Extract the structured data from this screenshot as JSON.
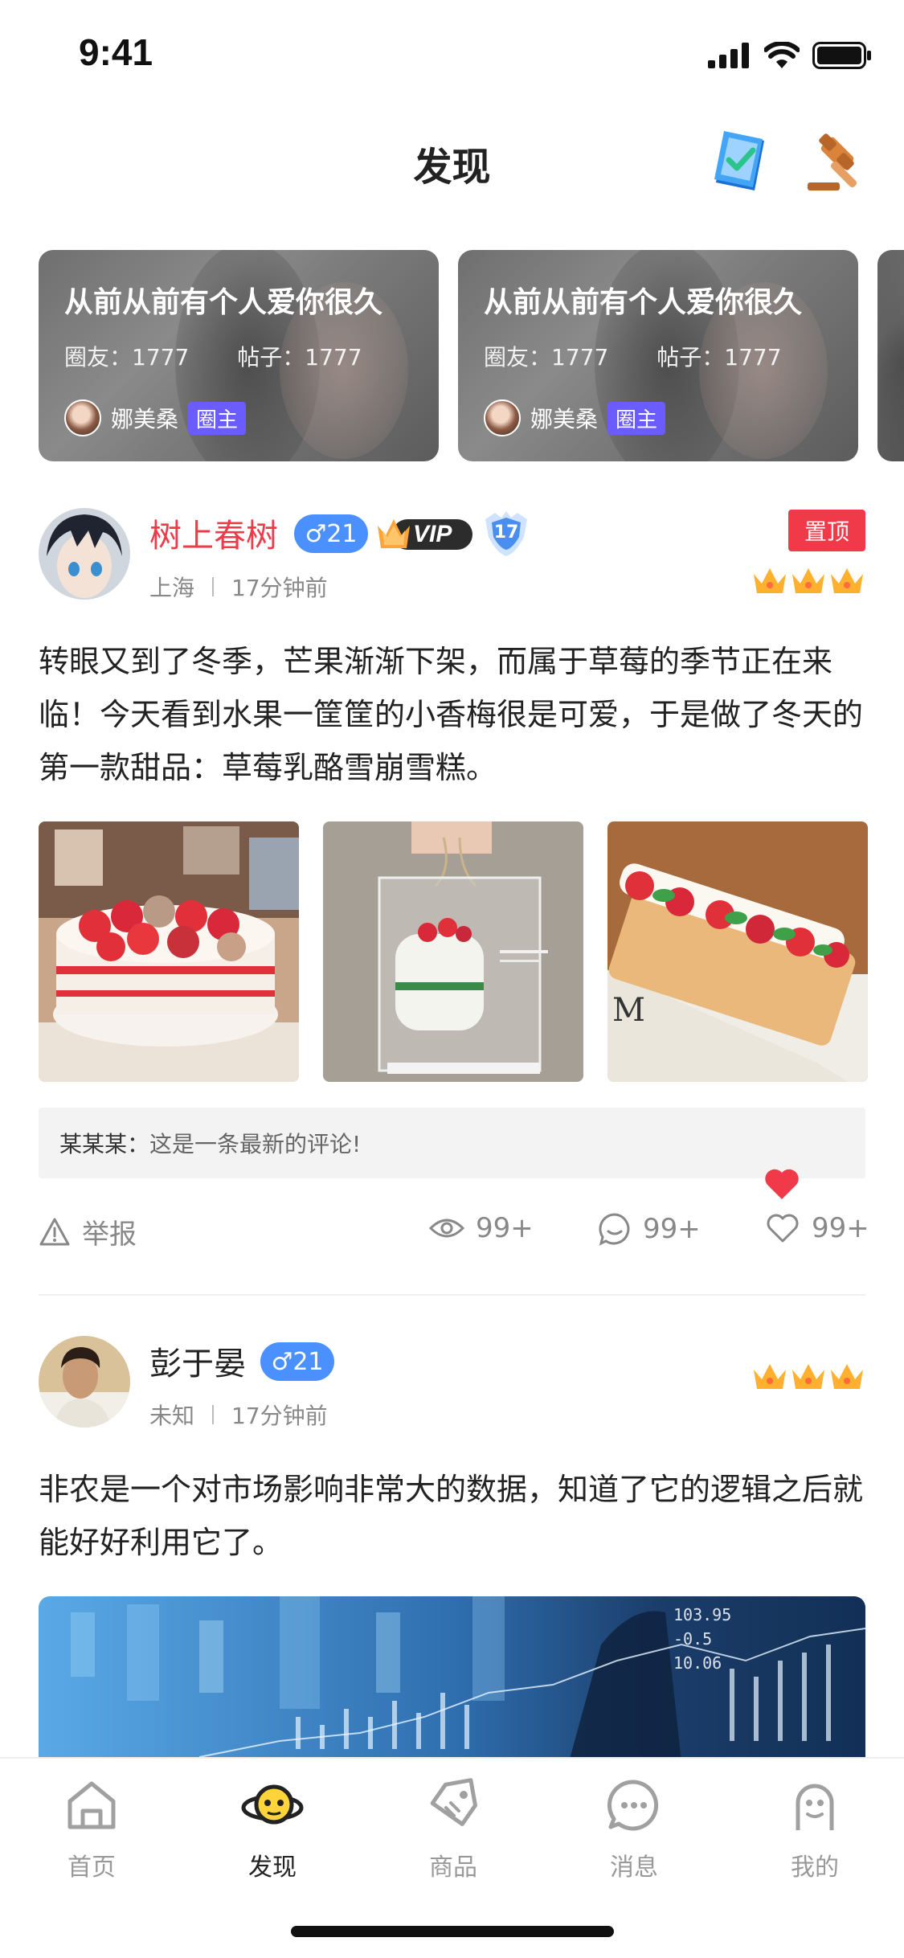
{
  "status_bar": {
    "time": "9:41"
  },
  "header": {
    "title": "发现",
    "icons": [
      "checklist-book-icon",
      "gavel-icon"
    ]
  },
  "circles": [
    {
      "title": "从前从前有个人爱你很久",
      "members_label": "圈友：1777",
      "posts_label": "帖子：1777",
      "owner": "娜美桑",
      "owner_tag": "圈主"
    },
    {
      "title": "从前从前有个人爱你很久",
      "members_label": "圈友：1777",
      "posts_label": "帖子：1777",
      "owner": "娜美桑",
      "owner_tag": "圈主"
    }
  ],
  "posts": [
    {
      "username": "树上春树",
      "username_color": "#f03a4a",
      "gender_badge": "♂21",
      "vip_label": "VIP",
      "level": "17",
      "pin_label": "置顶",
      "location": "上海",
      "time": "17分钟前",
      "text": "转眼又到了冬季，芒果渐渐下架，而属于草莓的季节正在来临！今天看到水果一筐筐的小香梅很是可爱，于是做了冬天的第一款甜品：草莓乳酪雪崩雪糕。",
      "images": [
        "strawberry-cake-photo",
        "boxed-cake-photo",
        "strawberry-roll-photo"
      ],
      "comment": {
        "user": "某某某：",
        "text": "这是一条最新的评论!"
      },
      "report_label": "举报",
      "views": "99+",
      "comments": "99+",
      "likes": "99+"
    },
    {
      "username": "彭于晏",
      "username_color": "#222222",
      "gender_badge": "♂21",
      "location": "未知",
      "time": "17分钟前",
      "text": "非农是一个对市场影响非常大的数据，知道了它的逻辑之后就能好好利用它了。",
      "images": [
        "stock-market-photo"
      ]
    }
  ],
  "tabbar": [
    {
      "label": "首页",
      "icon": "home-icon",
      "active": false
    },
    {
      "label": "发现",
      "icon": "discover-icon",
      "active": true
    },
    {
      "label": "商品",
      "icon": "tag-icon",
      "active": false
    },
    {
      "label": "消息",
      "icon": "message-icon",
      "active": false
    },
    {
      "label": "我的",
      "icon": "profile-icon",
      "active": false
    }
  ],
  "colors": {
    "accent_red": "#f03a4a",
    "badge_blue": "#4a90ff",
    "owner_tag": "#6a5cff",
    "like_red": "#f03a4a"
  }
}
